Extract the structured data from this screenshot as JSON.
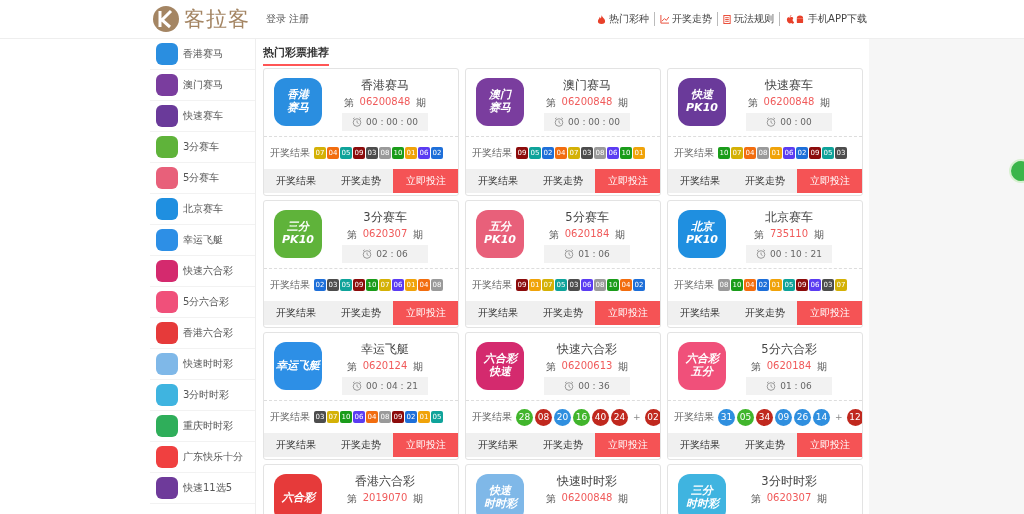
{
  "header": {
    "logo_text": "客拉客",
    "auth_links": [
      "登录",
      "注册"
    ],
    "nav": [
      {
        "kind": "fire",
        "label": "热门彩种"
      },
      {
        "kind": "chart",
        "label": "开奖走势"
      },
      {
        "kind": "doc",
        "label": "玩法规则"
      },
      {
        "kind": "phone",
        "label": "手机APP下载"
      }
    ]
  },
  "sidebar": {
    "items": [
      {
        "label": "香港赛马",
        "color": "#2a8ee0"
      },
      {
        "label": "澳门赛马",
        "color": "#7a3d9e"
      },
      {
        "label": "快速赛车",
        "color": "#6a3a9a"
      },
      {
        "label": "3分赛车",
        "color": "#5fb33a"
      },
      {
        "label": "5分赛车",
        "color": "#e8607a"
      },
      {
        "label": "北京赛车",
        "color": "#1f8fe0"
      },
      {
        "label": "幸运飞艇",
        "color": "#2d8fe6"
      },
      {
        "label": "快速六合彩",
        "color": "#d42a6e"
      },
      {
        "label": "5分六合彩",
        "color": "#f0507a"
      },
      {
        "label": "香港六合彩",
        "color": "#e63a3a"
      },
      {
        "label": "快速时时彩",
        "color": "#7fb8e8"
      },
      {
        "label": "3分时时彩",
        "color": "#3fb4e0"
      },
      {
        "label": "重庆时时彩",
        "color": "#2fae5a"
      },
      {
        "label": "广东快乐十分",
        "color": "#f04040"
      },
      {
        "label": "快速11选5",
        "color": "#6e3a9a"
      }
    ]
  },
  "section_title": "热门彩票推荐",
  "cards": [
    {
      "title": "香港赛马",
      "issue_prefix": "第",
      "issue": "06200848",
      "issue_suffix": "期",
      "timer": "00 : 00 : 00",
      "icon": {
        "color": "#2a8ee0",
        "lines": [
          "香港",
          "赛马"
        ]
      },
      "results_label": "开奖结果",
      "results": [
        {
          "kind": "square",
          "text": "07",
          "color": "#d4b106"
        },
        {
          "kind": "square",
          "text": "04",
          "color": "#f26d0f"
        },
        {
          "kind": "square",
          "text": "05",
          "color": "#0fa39a"
        },
        {
          "kind": "square",
          "text": "09",
          "color": "#8c0c0c"
        },
        {
          "kind": "square",
          "text": "03",
          "color": "#4d4d4d"
        },
        {
          "kind": "square",
          "text": "08",
          "color": "#9a9a9a"
        },
        {
          "kind": "square",
          "text": "10",
          "color": "#1a9c1a"
        },
        {
          "kind": "square",
          "text": "01",
          "color": "#f0a30a"
        },
        {
          "kind": "square",
          "text": "06",
          "color": "#5b3cf2"
        },
        {
          "kind": "square",
          "text": "02",
          "color": "#1e6fd9"
        }
      ],
      "buttons": [
        {
          "label": "开奖结果",
          "kind": "plain"
        },
        {
          "label": "开奖走势",
          "kind": "plain"
        },
        {
          "label": "立即投注",
          "kind": "primary"
        }
      ]
    },
    {
      "title": "澳门赛马",
      "issue_prefix": "第",
      "issue": "06200848",
      "issue_suffix": "期",
      "timer": "00 : 00 : 00",
      "icon": {
        "color": "#7a3d9e",
        "lines": [
          "澳门",
          "赛马"
        ]
      },
      "results_label": "开奖结果",
      "results": [
        {
          "kind": "square",
          "text": "09",
          "color": "#8c0c0c"
        },
        {
          "kind": "square",
          "text": "05",
          "color": "#0fa39a"
        },
        {
          "kind": "square",
          "text": "02",
          "color": "#1e6fd9"
        },
        {
          "kind": "square",
          "text": "04",
          "color": "#f26d0f"
        },
        {
          "kind": "square",
          "text": "07",
          "color": "#d4b106"
        },
        {
          "kind": "square",
          "text": "03",
          "color": "#4d4d4d"
        },
        {
          "kind": "square",
          "text": "08",
          "color": "#9a9a9a"
        },
        {
          "kind": "square",
          "text": "06",
          "color": "#5b3cf2"
        },
        {
          "kind": "square",
          "text": "10",
          "color": "#1a9c1a"
        },
        {
          "kind": "square",
          "text": "01",
          "color": "#f0a30a"
        }
      ],
      "buttons": [
        {
          "label": "开奖结果",
          "kind": "plain"
        },
        {
          "label": "开奖走势",
          "kind": "plain"
        },
        {
          "label": "立即投注",
          "kind": "primary"
        }
      ]
    },
    {
      "title": "快速赛车",
      "issue_prefix": "第",
      "issue": "06200848",
      "issue_suffix": "期",
      "timer": "00 : 00",
      "icon": {
        "color": "#6a3a9a",
        "lines": [
          "快速",
          "PK10"
        ]
      },
      "results_label": "开奖结果",
      "results": [
        {
          "kind": "square",
          "text": "10",
          "color": "#1a9c1a"
        },
        {
          "kind": "square",
          "text": "07",
          "color": "#d4b106"
        },
        {
          "kind": "square",
          "text": "04",
          "color": "#f26d0f"
        },
        {
          "kind": "square",
          "text": "08",
          "color": "#9a9a9a"
        },
        {
          "kind": "square",
          "text": "01",
          "color": "#f0a30a"
        },
        {
          "kind": "square",
          "text": "06",
          "color": "#5b3cf2"
        },
        {
          "kind": "square",
          "text": "02",
          "color": "#1e6fd9"
        },
        {
          "kind": "square",
          "text": "09",
          "color": "#8c0c0c"
        },
        {
          "kind": "square",
          "text": "05",
          "color": "#0fa39a"
        },
        {
          "kind": "square",
          "text": "03",
          "color": "#4d4d4d"
        }
      ],
      "buttons": [
        {
          "label": "开奖结果",
          "kind": "plain"
        },
        {
          "label": "开奖走势",
          "kind": "plain"
        },
        {
          "label": "立即投注",
          "kind": "primary"
        }
      ]
    },
    {
      "title": "3分赛车",
      "issue_prefix": "第",
      "issue": "0620307",
      "issue_suffix": "期",
      "timer": "02 : 06",
      "icon": {
        "color": "#5fb33a",
        "lines": [
          "三分",
          "PK10"
        ]
      },
      "results_label": "开奖结果",
      "results": [
        {
          "kind": "square",
          "text": "02",
          "color": "#1e6fd9"
        },
        {
          "kind": "square",
          "text": "03",
          "color": "#4d4d4d"
        },
        {
          "kind": "square",
          "text": "05",
          "color": "#0fa39a"
        },
        {
          "kind": "square",
          "text": "09",
          "color": "#8c0c0c"
        },
        {
          "kind": "square",
          "text": "10",
          "color": "#1a9c1a"
        },
        {
          "kind": "square",
          "text": "07",
          "color": "#d4b106"
        },
        {
          "kind": "square",
          "text": "06",
          "color": "#5b3cf2"
        },
        {
          "kind": "square",
          "text": "01",
          "color": "#f0a30a"
        },
        {
          "kind": "square",
          "text": "04",
          "color": "#f26d0f"
        },
        {
          "kind": "square",
          "text": "08",
          "color": "#9a9a9a"
        }
      ],
      "buttons": [
        {
          "label": "开奖结果",
          "kind": "plain"
        },
        {
          "label": "开奖走势",
          "kind": "plain"
        },
        {
          "label": "立即投注",
          "kind": "primary"
        }
      ]
    },
    {
      "title": "5分赛车",
      "issue_prefix": "第",
      "issue": "0620184",
      "issue_suffix": "期",
      "timer": "01 : 06",
      "icon": {
        "color": "#e8607a",
        "lines": [
          "五分",
          "PK10"
        ]
      },
      "results_label": "开奖结果",
      "results": [
        {
          "kind": "square",
          "text": "09",
          "color": "#8c0c0c"
        },
        {
          "kind": "square",
          "text": "01",
          "color": "#f0a30a"
        },
        {
          "kind": "square",
          "text": "07",
          "color": "#d4b106"
        },
        {
          "kind": "square",
          "text": "05",
          "color": "#0fa39a"
        },
        {
          "kind": "square",
          "text": "03",
          "color": "#4d4d4d"
        },
        {
          "kind": "square",
          "text": "06",
          "color": "#5b3cf2"
        },
        {
          "kind": "square",
          "text": "08",
          "color": "#9a9a9a"
        },
        {
          "kind": "square",
          "text": "10",
          "color": "#1a9c1a"
        },
        {
          "kind": "square",
          "text": "04",
          "color": "#f26d0f"
        },
        {
          "kind": "square",
          "text": "02",
          "color": "#1e6fd9"
        }
      ],
      "buttons": [
        {
          "label": "开奖结果",
          "kind": "plain"
        },
        {
          "label": "开奖走势",
          "kind": "plain"
        },
        {
          "label": "立即投注",
          "kind": "primary"
        }
      ]
    },
    {
      "title": "北京赛车",
      "issue_prefix": "第",
      "issue": "735110",
      "issue_suffix": "期",
      "timer": "00 : 10 : 21",
      "icon": {
        "color": "#1f8fe0",
        "lines": [
          "北京",
          "PK10"
        ]
      },
      "results_label": "开奖结果",
      "results": [
        {
          "kind": "square",
          "text": "08",
          "color": "#9a9a9a"
        },
        {
          "kind": "square",
          "text": "10",
          "color": "#1a9c1a"
        },
        {
          "kind": "square",
          "text": "04",
          "color": "#f26d0f"
        },
        {
          "kind": "square",
          "text": "02",
          "color": "#1e6fd9"
        },
        {
          "kind": "square",
          "text": "01",
          "color": "#f0a30a"
        },
        {
          "kind": "square",
          "text": "05",
          "color": "#0fa39a"
        },
        {
          "kind": "square",
          "text": "09",
          "color": "#8c0c0c"
        },
        {
          "kind": "square",
          "text": "06",
          "color": "#5b3cf2"
        },
        {
          "kind": "square",
          "text": "03",
          "color": "#4d4d4d"
        },
        {
          "kind": "square",
          "text": "07",
          "color": "#d4b106"
        }
      ],
      "buttons": [
        {
          "label": "开奖结果",
          "kind": "plain"
        },
        {
          "label": "开奖走势",
          "kind": "plain"
        },
        {
          "label": "立即投注",
          "kind": "primary"
        }
      ]
    },
    {
      "title": "幸运飞艇",
      "issue_prefix": "第",
      "issue": "0620124",
      "issue_suffix": "期",
      "timer": "00 : 04 : 21",
      "icon": {
        "color": "#2d8fe6",
        "lines": [
          "幸运飞艇"
        ]
      },
      "results_label": "开奖结果",
      "results": [
        {
          "kind": "square",
          "text": "03",
          "color": "#4d4d4d"
        },
        {
          "kind": "square",
          "text": "07",
          "color": "#d4b106"
        },
        {
          "kind": "square",
          "text": "10",
          "color": "#1a9c1a"
        },
        {
          "kind": "square",
          "text": "06",
          "color": "#5b3cf2"
        },
        {
          "kind": "square",
          "text": "04",
          "color": "#f26d0f"
        },
        {
          "kind": "square",
          "text": "08",
          "color": "#9a9a9a"
        },
        {
          "kind": "square",
          "text": "09",
          "color": "#8c0c0c"
        },
        {
          "kind": "square",
          "text": "02",
          "color": "#1e6fd9"
        },
        {
          "kind": "square",
          "text": "01",
          "color": "#f0a30a"
        },
        {
          "kind": "square",
          "text": "05",
          "color": "#0fa39a"
        }
      ],
      "buttons": [
        {
          "label": "开奖结果",
          "kind": "plain"
        },
        {
          "label": "开奖走势",
          "kind": "plain"
        },
        {
          "label": "立即投注",
          "kind": "primary"
        }
      ]
    },
    {
      "title": "快速六合彩",
      "issue_prefix": "第",
      "issue": "06200613",
      "issue_suffix": "期",
      "timer": "00 : 36",
      "icon": {
        "color": "#d42a6e",
        "lines": [
          "六合彩",
          "快速"
        ]
      },
      "results_label": "开奖结果",
      "results": [
        {
          "kind": "round",
          "text": "28",
          "color": "#41b52c"
        },
        {
          "kind": "round",
          "text": "08",
          "color": "#c0281e"
        },
        {
          "kind": "round",
          "text": "20",
          "color": "#2f8fdf"
        },
        {
          "kind": "round",
          "text": "16",
          "color": "#41b52c"
        },
        {
          "kind": "round",
          "text": "40",
          "color": "#c0281e"
        },
        {
          "kind": "round",
          "text": "24",
          "color": "#c0281e"
        },
        {
          "kind": "plus",
          "text": "+"
        },
        {
          "kind": "round",
          "text": "02",
          "color": "#c0281e"
        }
      ],
      "buttons": [
        {
          "label": "开奖结果",
          "kind": "plain"
        },
        {
          "label": "开奖走势",
          "kind": "plain"
        },
        {
          "label": "立即投注",
          "kind": "primary"
        }
      ]
    },
    {
      "title": "5分六合彩",
      "issue_prefix": "第",
      "issue": "0620184",
      "issue_suffix": "期",
      "timer": "01 : 06",
      "icon": {
        "color": "#f0507a",
        "lines": [
          "六合彩",
          "五分"
        ]
      },
      "results_label": "开奖结果",
      "results": [
        {
          "kind": "round",
          "text": "31",
          "color": "#2f8fdf"
        },
        {
          "kind": "round",
          "text": "05",
          "color": "#41b52c"
        },
        {
          "kind": "round",
          "text": "34",
          "color": "#c0281e"
        },
        {
          "kind": "round",
          "text": "09",
          "color": "#2f8fdf"
        },
        {
          "kind": "round",
          "text": "26",
          "color": "#2f8fdf"
        },
        {
          "kind": "round",
          "text": "14",
          "color": "#2f8fdf"
        },
        {
          "kind": "plus",
          "text": "+"
        },
        {
          "kind": "round",
          "text": "12",
          "color": "#c0281e"
        }
      ],
      "buttons": [
        {
          "label": "开奖结果",
          "kind": "plain"
        },
        {
          "label": "开奖走势",
          "kind": "plain"
        },
        {
          "label": "立即投注",
          "kind": "primary"
        }
      ]
    },
    {
      "title": "香港六合彩",
      "issue_prefix": "第",
      "issue": "2019070",
      "issue_suffix": "期",
      "icon": {
        "color": "#e63a3a",
        "lines": [
          "六合彩"
        ]
      }
    },
    {
      "title": "快速时时彩",
      "issue_prefix": "第",
      "issue": "06200848",
      "issue_suffix": "期",
      "icon": {
        "color": "#7fb8e8",
        "lines": [
          "快速",
          "时时彩"
        ]
      }
    },
    {
      "title": "3分时时彩",
      "issue_prefix": "第",
      "issue": "0620307",
      "issue_suffix": "期",
      "icon": {
        "color": "#3fb4e0",
        "lines": [
          "三分",
          "时时彩"
        ]
      }
    }
  ]
}
